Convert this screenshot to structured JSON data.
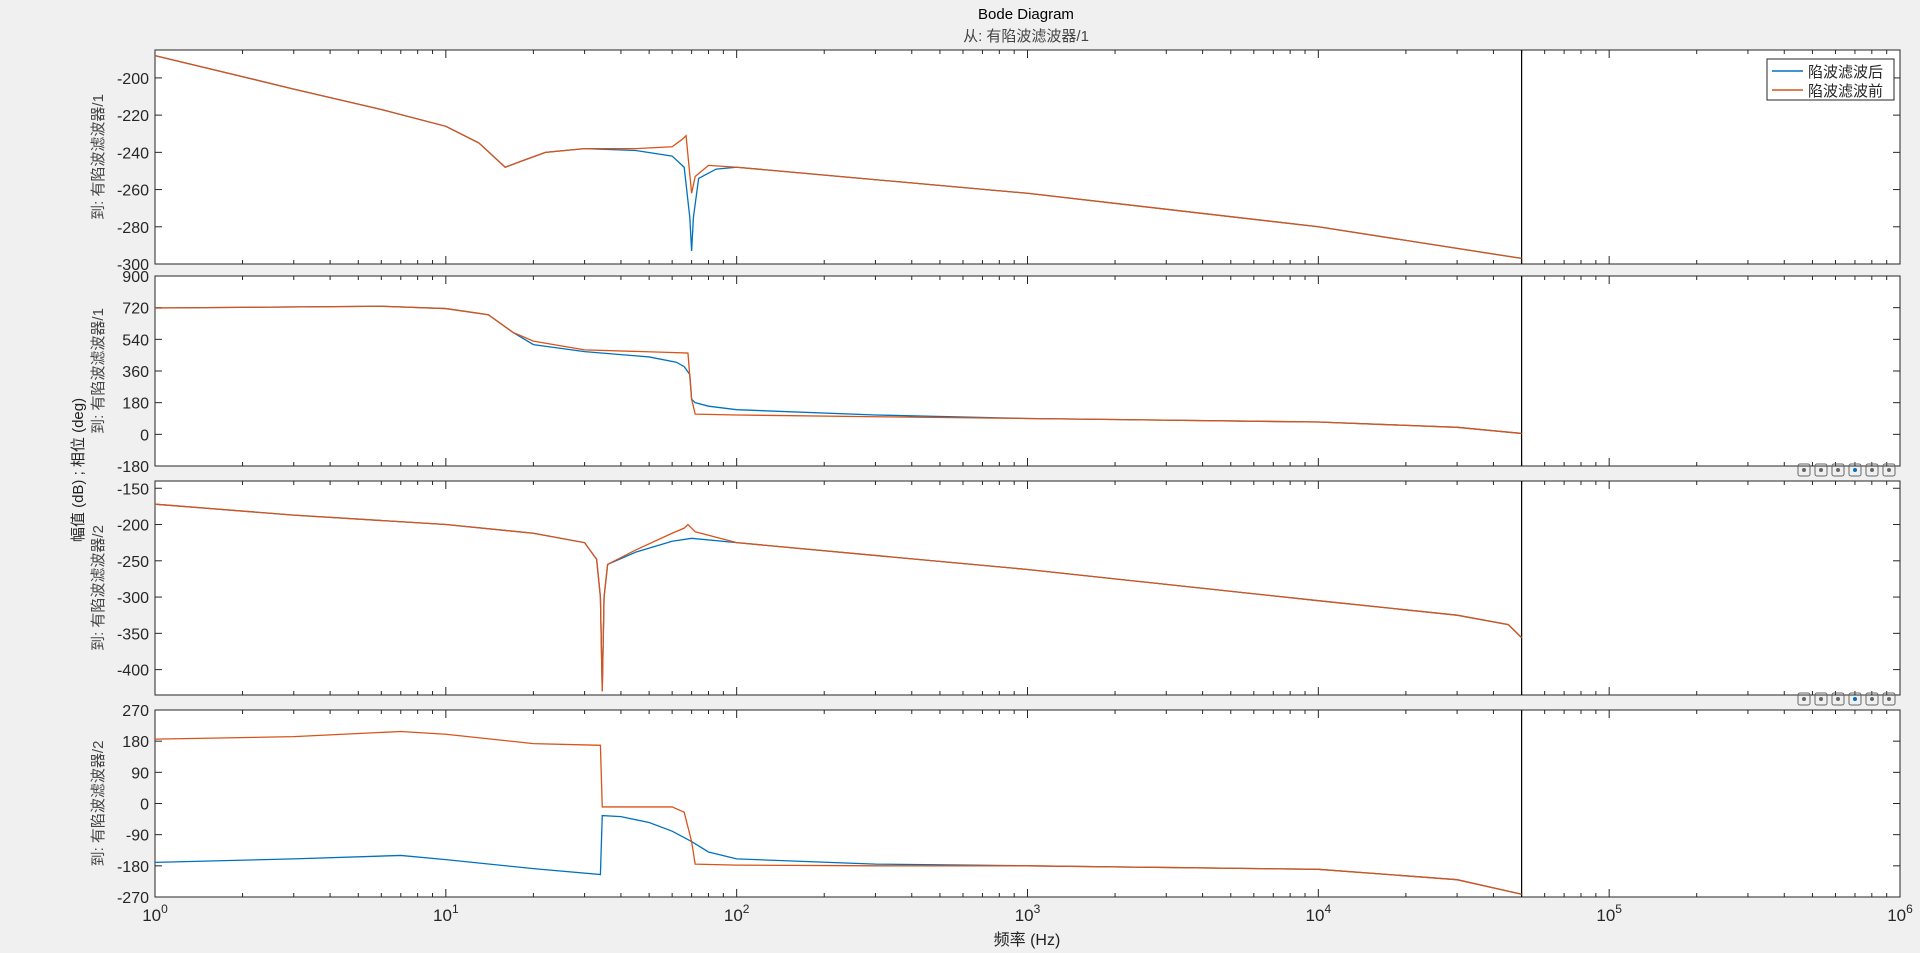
{
  "chart_data": {
    "type": "line",
    "title": "Bode Diagram",
    "subtitle": "从: 有陷波滤波器/1",
    "xlabel": "频率 (Hz)",
    "ylabel": "幅值 (dB) ; 相位 (deg)",
    "xscale": "log",
    "xlim": [
      1,
      1000000
    ],
    "xticks": [
      {
        "value": 1,
        "label": "10^0"
      },
      {
        "value": 10,
        "label": "10^1"
      },
      {
        "value": 100,
        "label": "10^2"
      },
      {
        "value": 1000,
        "label": "10^3"
      },
      {
        "value": 10000,
        "label": "10^4"
      },
      {
        "value": 100000,
        "label": "10^5"
      },
      {
        "value": 1000000,
        "label": "10^6"
      }
    ],
    "nyquist_line_hz": 50000,
    "grid": false,
    "legend": {
      "placement": "top-right",
      "entries": [
        "陷波滤波后",
        "陷波滤波前"
      ]
    },
    "colors": {
      "after": "#0072BD",
      "before": "#D95319"
    },
    "panels": [
      {
        "id": "mag1",
        "ylabel": "到: 有陷波滤波器/1",
        "ylim": [
          -300,
          -185
        ],
        "yticks": [
          -200,
          -220,
          -240,
          -260,
          -280,
          -300
        ],
        "series": [
          {
            "name": "陷波滤波后",
            "points": [
              [
                1,
                -188
              ],
              [
                3,
                -206
              ],
              [
                6,
                -217
              ],
              [
                10,
                -226
              ],
              [
                13,
                -235
              ],
              [
                16,
                -248
              ],
              [
                18,
                -245
              ],
              [
                22,
                -240
              ],
              [
                30,
                -238
              ],
              [
                45,
                -239
              ],
              [
                60,
                -242
              ],
              [
                66,
                -248
              ],
              [
                69,
                -275
              ],
              [
                70,
                -293
              ],
              [
                71,
                -275
              ],
              [
                74,
                -254
              ],
              [
                85,
                -249
              ],
              [
                100,
                -248
              ],
              [
                1000,
                -262
              ],
              [
                10000,
                -280
              ],
              [
                50000,
                -297
              ]
            ]
          },
          {
            "name": "陷波滤波前",
            "points": [
              [
                1,
                -188
              ],
              [
                3,
                -206
              ],
              [
                6,
                -217
              ],
              [
                10,
                -226
              ],
              [
                13,
                -235
              ],
              [
                16,
                -248
              ],
              [
                18,
                -245
              ],
              [
                22,
                -240
              ],
              [
                30,
                -238
              ],
              [
                45,
                -238
              ],
              [
                60,
                -237
              ],
              [
                65,
                -233
              ],
              [
                67,
                -231
              ],
              [
                69,
                -252
              ],
              [
                70,
                -262
              ],
              [
                72,
                -253
              ],
              [
                80,
                -247
              ],
              [
                100,
                -248
              ],
              [
                1000,
                -262
              ],
              [
                10000,
                -280
              ],
              [
                50000,
                -297
              ]
            ]
          }
        ]
      },
      {
        "id": "phase1",
        "ylabel": "到: 有陷波滤波器/1",
        "ylim": [
          -180,
          900
        ],
        "yticks": [
          900,
          720,
          540,
          360,
          180,
          0,
          -180
        ],
        "series": [
          {
            "name": "陷波滤波后",
            "points": [
              [
                1,
                718
              ],
              [
                6,
                728
              ],
              [
                10,
                715
              ],
              [
                14,
                680
              ],
              [
                17,
                580
              ],
              [
                20,
                510
              ],
              [
                30,
                470
              ],
              [
                50,
                440
              ],
              [
                62,
                410
              ],
              [
                66,
                385
              ],
              [
                69,
                340
              ],
              [
                70,
                200
              ],
              [
                72,
                180
              ],
              [
                80,
                160
              ],
              [
                100,
                140
              ],
              [
                300,
                110
              ],
              [
                1000,
                90
              ],
              [
                10000,
                70
              ],
              [
                30000,
                40
              ],
              [
                50000,
                5
              ]
            ]
          },
          {
            "name": "陷波滤波前",
            "points": [
              [
                1,
                718
              ],
              [
                6,
                728
              ],
              [
                10,
                715
              ],
              [
                14,
                680
              ],
              [
                17,
                580
              ],
              [
                20,
                530
              ],
              [
                30,
                480
              ],
              [
                60,
                465
              ],
              [
                68,
                462
              ],
              [
                70,
                200
              ],
              [
                72,
                115
              ],
              [
                100,
                110
              ],
              [
                300,
                100
              ],
              [
                1000,
                90
              ],
              [
                10000,
                70
              ],
              [
                30000,
                40
              ],
              [
                50000,
                5
              ]
            ]
          }
        ]
      },
      {
        "id": "mag2",
        "ylabel": "到: 有陷波滤波器/2",
        "ylim": [
          -435,
          -140
        ],
        "yticks": [
          -150,
          -200,
          -250,
          -300,
          -350,
          -400
        ],
        "series": [
          {
            "name": "陷波滤波后",
            "points": [
              [
                1,
                -172
              ],
              [
                3,
                -187
              ],
              [
                10,
                -200
              ],
              [
                20,
                -212
              ],
              [
                30,
                -225
              ],
              [
                33,
                -248
              ],
              [
                34,
                -300
              ],
              [
                34.5,
                -430
              ],
              [
                35,
                -300
              ],
              [
                36,
                -255
              ],
              [
                45,
                -238
              ],
              [
                60,
                -223
              ],
              [
                70,
                -219
              ],
              [
                100,
                -225
              ],
              [
                1000,
                -262
              ],
              [
                10000,
                -305
              ],
              [
                30000,
                -325
              ],
              [
                45000,
                -338
              ],
              [
                50000,
                -356
              ]
            ]
          },
          {
            "name": "陷波滤波前",
            "points": [
              [
                1,
                -172
              ],
              [
                3,
                -187
              ],
              [
                10,
                -200
              ],
              [
                20,
                -212
              ],
              [
                30,
                -225
              ],
              [
                33,
                -248
              ],
              [
                34,
                -300
              ],
              [
                34.5,
                -430
              ],
              [
                35,
                -300
              ],
              [
                36,
                -255
              ],
              [
                45,
                -235
              ],
              [
                60,
                -212
              ],
              [
                66,
                -205
              ],
              [
                68,
                -200
              ],
              [
                72,
                -210
              ],
              [
                100,
                -225
              ],
              [
                1000,
                -262
              ],
              [
                10000,
                -305
              ],
              [
                30000,
                -325
              ],
              [
                45000,
                -338
              ],
              [
                50000,
                -356
              ]
            ]
          }
        ]
      },
      {
        "id": "phase2",
        "ylabel": "到: 有陷波滤波器/2",
        "ylim": [
          -270,
          270
        ],
        "yticks": [
          270,
          180,
          90,
          0,
          -90,
          -180,
          -270
        ],
        "series": [
          {
            "name": "陷波滤波后",
            "points": [
              [
                1,
                -170
              ],
              [
                3,
                -160
              ],
              [
                7,
                -150
              ],
              [
                10,
                -162
              ],
              [
                20,
                -188
              ],
              [
                34,
                -205
              ],
              [
                34.5,
                -35
              ],
              [
                40,
                -38
              ],
              [
                50,
                -55
              ],
              [
                60,
                -80
              ],
              [
                70,
                -110
              ],
              [
                80,
                -140
              ],
              [
                100,
                -160
              ],
              [
                300,
                -175
              ],
              [
                1000,
                -180
              ],
              [
                10000,
                -190
              ],
              [
                30000,
                -220
              ],
              [
                50000,
                -262
              ]
            ]
          },
          {
            "name": "陷波滤波前",
            "points": [
              [
                1,
                186
              ],
              [
                3,
                193
              ],
              [
                7,
                208
              ],
              [
                10,
                200
              ],
              [
                20,
                173
              ],
              [
                34,
                168
              ],
              [
                34.5,
                -10
              ],
              [
                40,
                -10
              ],
              [
                60,
                -10
              ],
              [
                66,
                -25
              ],
              [
                70,
                -110
              ],
              [
                72,
                -175
              ],
              [
                100,
                -178
              ],
              [
                300,
                -180
              ],
              [
                1000,
                -180
              ],
              [
                10000,
                -190
              ],
              [
                30000,
                -220
              ],
              [
                50000,
                -262
              ]
            ]
          }
        ]
      }
    ]
  },
  "toolbar": {
    "icons": [
      "brush-icon",
      "datatip-icon",
      "pan-icon",
      "zoom-in-icon",
      "zoom-out-icon",
      "home-icon"
    ]
  }
}
